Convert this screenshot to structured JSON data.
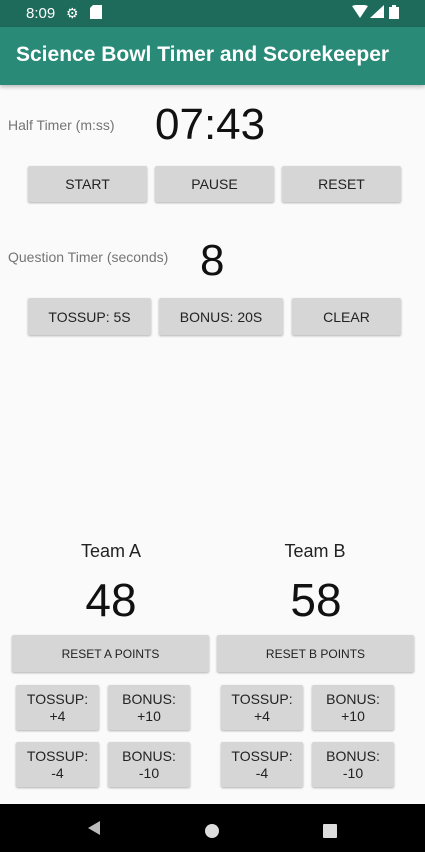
{
  "status": {
    "time": "8:09",
    "gear_icon": "gear-icon",
    "sd_icon": "sd-card-icon",
    "wifi_icon": "wifi-icon",
    "signal_icon": "signal-icon",
    "battery_icon": "battery-icon"
  },
  "app": {
    "title": "Science Bowl Timer and Scorekeeper"
  },
  "half_timer": {
    "label": "Half Timer (m:ss)",
    "value": "07:43",
    "start": "START",
    "pause": "PAUSE",
    "reset": "RESET"
  },
  "question_timer": {
    "label": "Question Timer (seconds)",
    "value": "8",
    "tossup": "TOSSUP: 5S",
    "bonus": "BONUS: 20S",
    "clear": "CLEAR"
  },
  "team_a": {
    "name": "Team A",
    "score": "48",
    "reset": "RESET A POINTS",
    "tossup_plus": "TOSSUP:\n+4",
    "bonus_plus": "BONUS:\n+10",
    "tossup_minus": "TOSSUP:\n-4",
    "bonus_minus": "BONUS:\n-10"
  },
  "team_b": {
    "name": "Team B",
    "score": "58",
    "reset": "RESET B POINTS",
    "tossup_plus": "TOSSUP:\n+4",
    "bonus_plus": "BONUS:\n+10",
    "tossup_minus": "TOSSUP:\n-4",
    "bonus_minus": "BONUS:\n-10"
  },
  "colors": {
    "status_bar": "#1f6b5b",
    "app_bar": "#2a8a78",
    "button": "#d6d6d6",
    "background": "#fafafa"
  }
}
